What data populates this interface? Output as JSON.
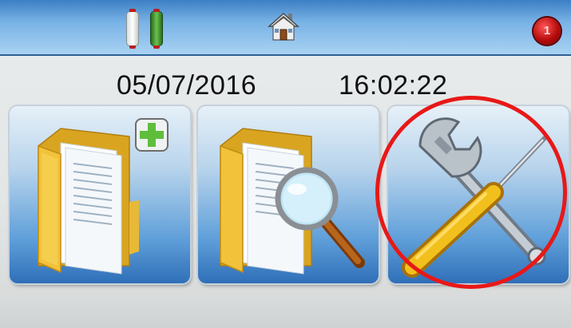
{
  "status_bar": {
    "battery_icons": [
      "battery-empty-icon",
      "battery-full-icon"
    ],
    "home_icon": "house-icon",
    "alarm_icon": "alarm-indicator-icon",
    "alarm_label": "1"
  },
  "clock": {
    "date": "05/07/2016",
    "time": "16:02:22"
  },
  "tiles": [
    {
      "id": "new-folder",
      "icon": "folder-add-icon"
    },
    {
      "id": "search-folder",
      "icon": "folder-search-icon"
    },
    {
      "id": "settings-tools",
      "icon": "wrench-screwdriver-icon"
    }
  ],
  "colors": {
    "header_blue": "#3c7fc4",
    "tile_blue": "#2f6fb8",
    "folder_yellow": "#f2c23a",
    "plus_green": "#5fbd3c",
    "annotation_red": "#e81818"
  }
}
